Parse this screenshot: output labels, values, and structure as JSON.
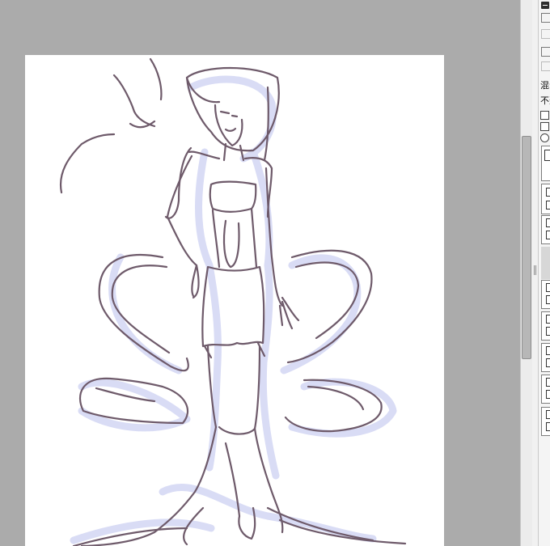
{
  "panel": {
    "blend_label": "混合",
    "opacity_label": "不透"
  },
  "colors": {
    "workspace": "#ababab",
    "canvas": "#ffffff",
    "line": "#6e5a6a",
    "blue_underdrawing": "#d9dcf5",
    "scroll_thumb": "#b7b7b7"
  },
  "icons": [
    "minimize-icon",
    "eye-icon",
    "checkbox-icon",
    "radio-icon"
  ]
}
